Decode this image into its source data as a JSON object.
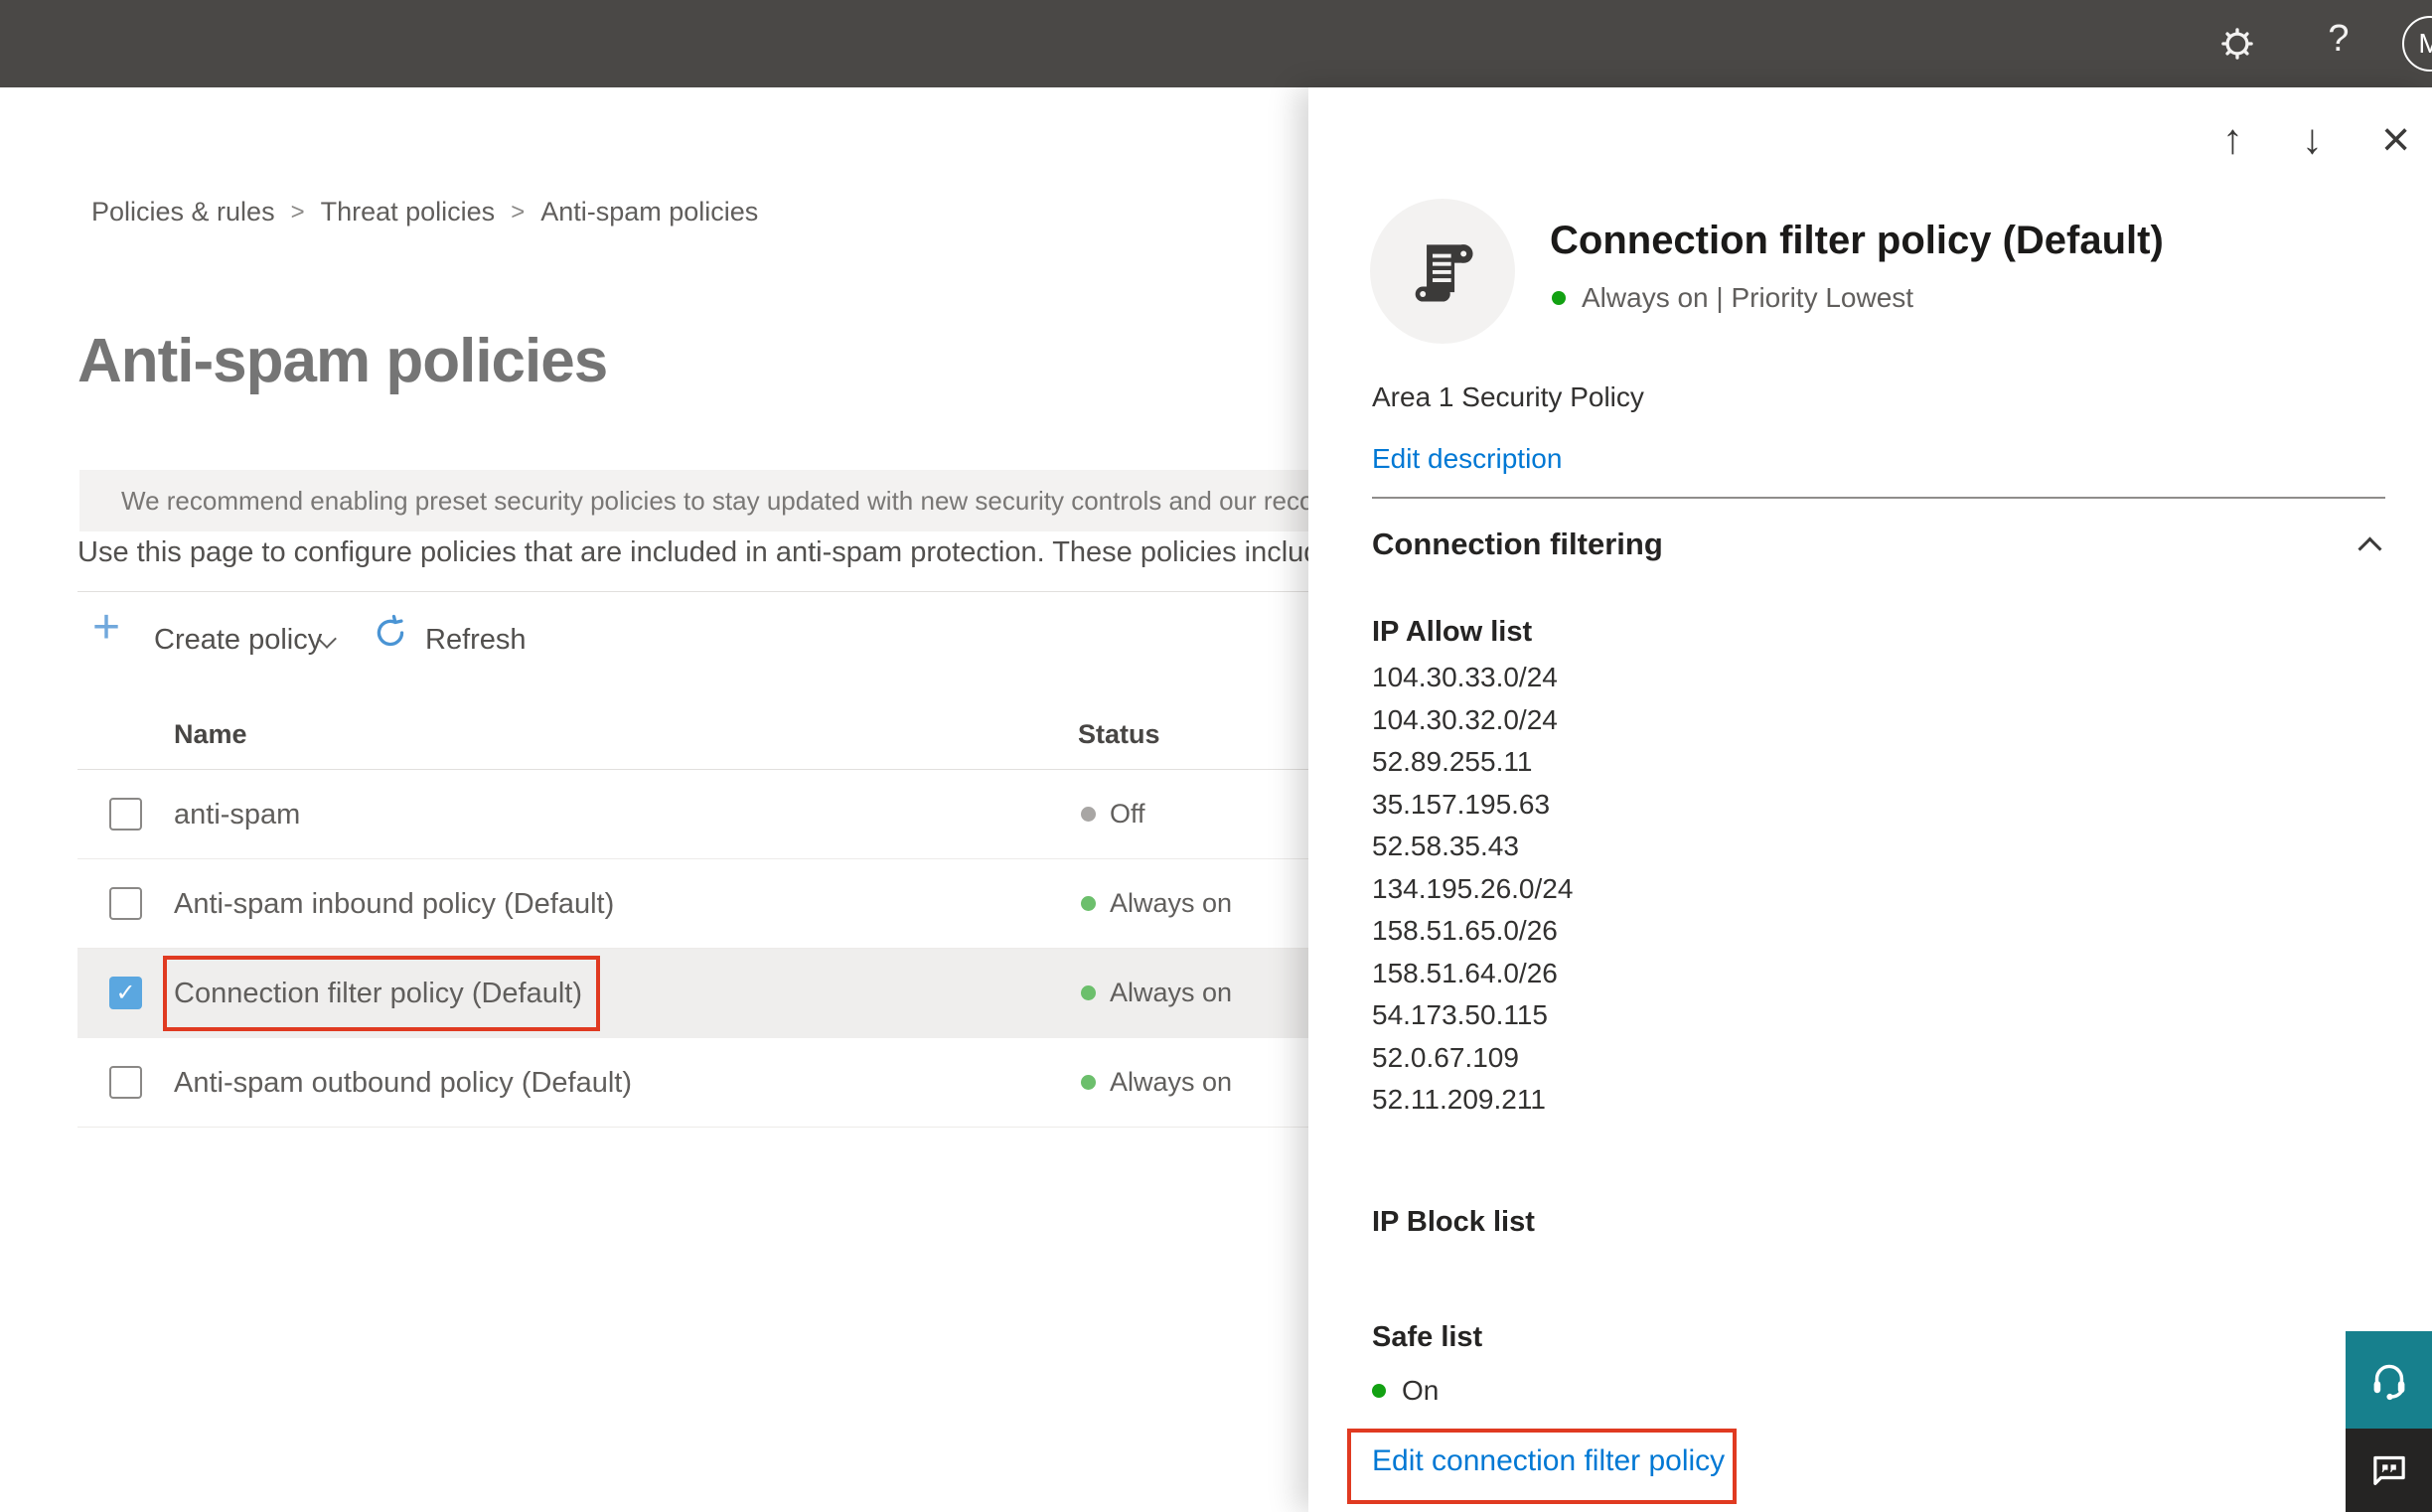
{
  "topbar": {
    "help_glyph": "?",
    "avatar_initial": "M"
  },
  "breadcrumb": {
    "separator": ">",
    "items": [
      "Policies & rules",
      "Threat policies",
      "Anti-spam policies"
    ]
  },
  "page": {
    "title": "Anti-spam policies",
    "banner_text": "We recommend enabling preset security policies to stay updated with new security controls and our recomme",
    "intro_text": "Use this page to configure policies that are included in anti-spam protection. These policies include",
    "toolbar": {
      "plus_glyph": "+",
      "create_policy_label": "Create policy",
      "refresh_label": "Refresh"
    }
  },
  "table": {
    "columns": {
      "name": "Name",
      "status": "Status"
    },
    "check_glyph": "✓",
    "rows": [
      {
        "name": "anti-spam",
        "status": "Off",
        "checked": false,
        "selected": false
      },
      {
        "name": "Anti-spam inbound policy (Default)",
        "status": "Always on",
        "checked": false,
        "selected": false
      },
      {
        "name": "Connection filter policy (Default)",
        "status": "Always on",
        "checked": true,
        "selected": true
      },
      {
        "name": "Anti-spam outbound policy (Default)",
        "status": "Always on",
        "checked": false,
        "selected": false
      }
    ]
  },
  "flyout": {
    "nav": {
      "up_glyph": "↑",
      "down_glyph": "↓",
      "close_glyph": "×"
    },
    "title": "Connection filter policy (Default)",
    "status_line": "Always on | Priority Lowest",
    "description": "Area 1 Security Policy",
    "edit_description_label": "Edit description",
    "section_title": "Connection filtering",
    "ip_allow": {
      "label": "IP Allow list",
      "items": [
        "104.30.33.0/24",
        "104.30.32.0/24",
        "52.89.255.11",
        "35.157.195.63",
        "52.58.35.43",
        "134.195.26.0/24",
        "158.51.65.0/26",
        "158.51.64.0/26",
        "54.173.50.115",
        "52.0.67.109",
        "52.11.209.211"
      ]
    },
    "ip_block": {
      "label": "IP Block list"
    },
    "safe_list": {
      "label": "Safe list",
      "value": "On"
    },
    "edit_link_label": "Edit connection filter policy"
  },
  "colors": {
    "topbar_bg": "#4a4846",
    "link_blue": "#0078d4",
    "status_green": "#6cbf6c",
    "status_green_bright": "#12a112",
    "status_gray": "#a8a6a4",
    "highlight_red": "#e03a21",
    "checkbox_blue": "#5ba7e0",
    "support_teal": "#17808d",
    "feedback_dark": "#252423",
    "banner_bg": "#f3f2f1"
  }
}
